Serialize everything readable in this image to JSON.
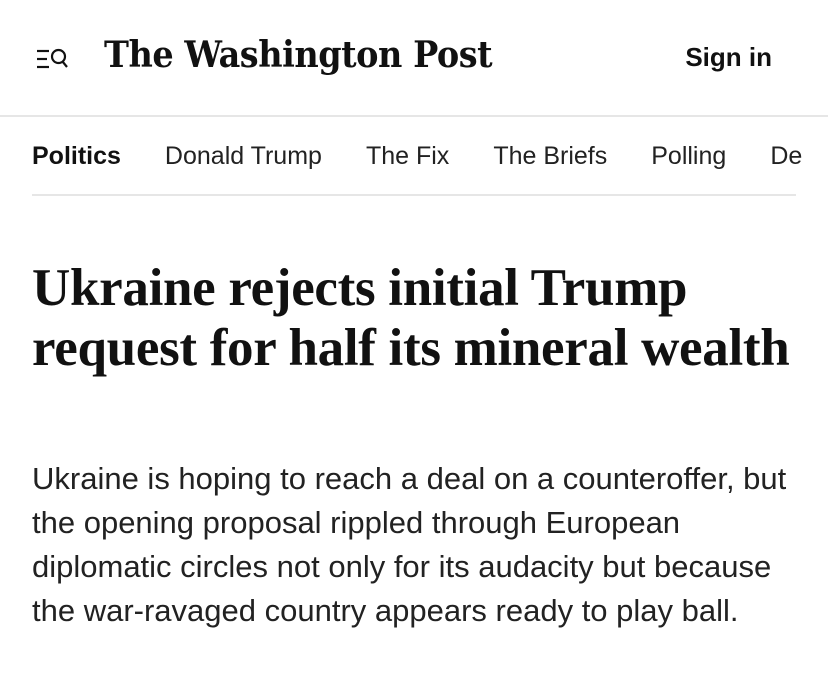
{
  "header": {
    "masthead": "The Washington Post",
    "sign_in_label": "Sign in",
    "menu_icon": "menu-search-icon"
  },
  "subnav": {
    "items": [
      {
        "label": "Politics",
        "active": true
      },
      {
        "label": "Donald Trump"
      },
      {
        "label": "The Fix"
      },
      {
        "label": "The Briefs"
      },
      {
        "label": "Polling"
      },
      {
        "label": "De"
      }
    ]
  },
  "article": {
    "headline": "Ukraine rejects initial Trump request for half its mineral wealth",
    "dek": "Ukraine is hoping to reach a deal on a counteroffer, but the opening proposal rippled through European diplomatic circles not only for its audacity but because the war-ravaged country appears ready to play ball."
  }
}
